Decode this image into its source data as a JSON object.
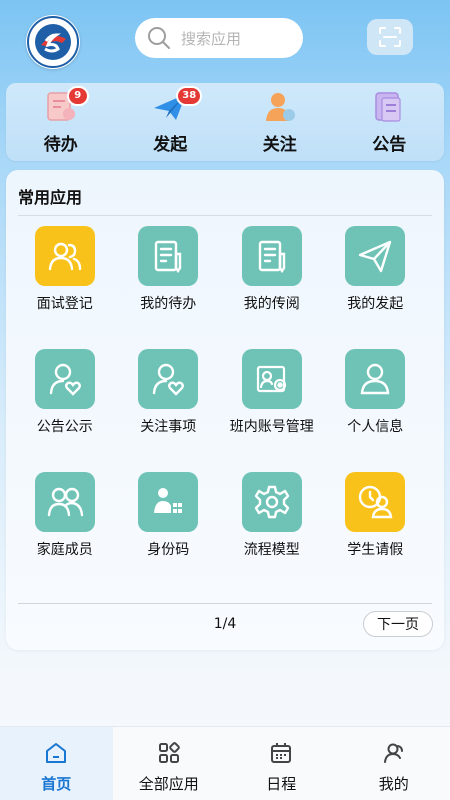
{
  "header": {
    "search_placeholder": "搜索应用",
    "logo_icon": "school-logo-icon",
    "scan_icon": "scan-icon"
  },
  "quick": [
    {
      "label": "待办",
      "icon": "todo-icon",
      "badge": "9"
    },
    {
      "label": "发起",
      "icon": "paper-plane-icon",
      "badge": "38"
    },
    {
      "label": "关注",
      "icon": "follow-icon",
      "badge": ""
    },
    {
      "label": "公告",
      "icon": "notice-icon",
      "badge": ""
    }
  ],
  "card": {
    "title": "常用应用",
    "apps": [
      {
        "label": "面试登记",
        "icon": "interview-icon",
        "color": "#f9c21b"
      },
      {
        "label": "我的待办",
        "icon": "document-edit-icon",
        "color": "#6ec3b6"
      },
      {
        "label": "我的传阅",
        "icon": "document-edit-icon",
        "color": "#6ec3b6"
      },
      {
        "label": "我的发起",
        "icon": "send-icon",
        "color": "#6ec3b6"
      },
      {
        "label": "公告公示",
        "icon": "user-heart-icon",
        "color": "#6ec3b6"
      },
      {
        "label": "关注事项",
        "icon": "user-heart-icon",
        "color": "#6ec3b6"
      },
      {
        "label": "班内账号管理",
        "icon": "account-settings-icon",
        "color": "#6ec3b6"
      },
      {
        "label": "个人信息",
        "icon": "person-icon",
        "color": "#6ec3b6"
      },
      {
        "label": "家庭成员",
        "icon": "family-icon",
        "color": "#6ec3b6"
      },
      {
        "label": "身份码",
        "icon": "id-code-icon",
        "color": "#6ec3b6"
      },
      {
        "label": "流程模型",
        "icon": "gear-icon",
        "color": "#6ec3b6"
      },
      {
        "label": "学生请假",
        "icon": "student-leave-icon",
        "color": "#f9c21b"
      }
    ],
    "page": "1/4",
    "next_label": "下一页"
  },
  "nav": [
    {
      "label": "首页",
      "icon": "home-icon",
      "active": true
    },
    {
      "label": "全部应用",
      "icon": "apps-icon",
      "active": false
    },
    {
      "label": "日程",
      "icon": "calendar-icon",
      "active": false
    },
    {
      "label": "我的",
      "icon": "profile-icon",
      "active": false
    }
  ],
  "colors": {
    "accent": "#1976d2",
    "teal": "#6ec3b6",
    "yellow": "#f9c21b",
    "badge": "#e53935"
  }
}
